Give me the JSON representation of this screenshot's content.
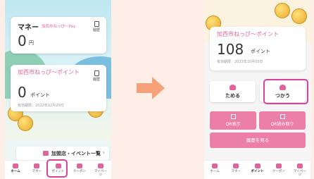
{
  "left": {
    "money_card": {
      "title": "マネー",
      "subtitle": "加西市ねっぴ〜Pay",
      "amount": "0",
      "unit": "円",
      "history": "履歴"
    },
    "point_card": {
      "title": "加西市ねっぴ〜ポイント",
      "amount": "0",
      "unit": "ポイント",
      "expiry": "有効期限：2022年12月20日",
      "history": "履歴"
    },
    "store_bar": {
      "label": "加盟店・イベント一覧"
    },
    "nav": [
      {
        "label": "ホーム",
        "icon": "home-icon"
      },
      {
        "label": "マネー",
        "icon": "wallet-icon"
      },
      {
        "label": "ポイント",
        "icon": "points-icon"
      },
      {
        "label": "クーポン",
        "icon": "ticket-icon"
      },
      {
        "label": "マイペー\nジ",
        "icon": "person-icon"
      }
    ]
  },
  "right": {
    "point_card": {
      "title": "加西市ねっぴ〜ポイント",
      "amount": "108",
      "unit": "ポイント",
      "expiry": "有効期限：2023年10月03日"
    },
    "actions": [
      {
        "label": "ためる",
        "icon": "piggy-bank-icon"
      },
      {
        "label": "つかう",
        "icon": "hand-coin-icon"
      }
    ],
    "qr_buttons": [
      {
        "label": "QR表示",
        "icon": "qr-icon"
      },
      {
        "label": "QR読み取り",
        "icon": "qr-scan-icon"
      }
    ],
    "history_button": "履歴を見る",
    "nav": [
      {
        "label": "ホーム",
        "icon": "home-icon"
      },
      {
        "label": "マネー",
        "icon": "wallet-icon"
      },
      {
        "label": "ポイント",
        "icon": "points-icon"
      },
      {
        "label": "クーポン",
        "icon": "ticket-icon"
      },
      {
        "label": "マイペー\nジ",
        "icon": "person-icon"
      }
    ]
  },
  "colors": {
    "pink": "#e0649b",
    "highlight": "#d6449b",
    "arrow": "#f5a27a"
  }
}
